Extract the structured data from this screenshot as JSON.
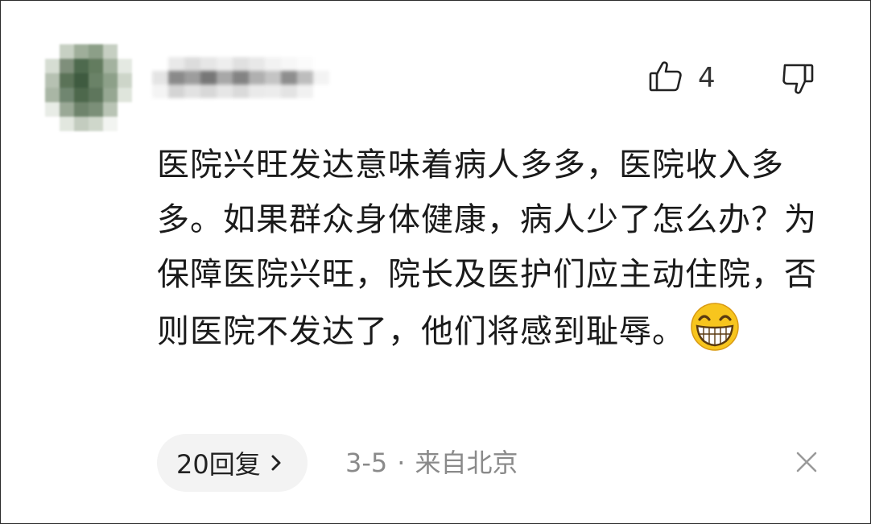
{
  "comment": {
    "like_count": "4",
    "text": "医院兴旺发达意味着病人多多，医院收入多多。如果群众身体健康，病人少了怎么办？为保障医院兴旺，院长及医护们应主动住院，否则医院不发达了，他们将感到耻辱。",
    "emoji": "grinning-face-emoji"
  },
  "footer": {
    "reply_label": "20回复",
    "date": "3-5",
    "separator": "·",
    "location": "来自北京"
  },
  "icons": {
    "like": "thumbs-up-icon",
    "dislike": "thumbs-down-icon",
    "reply_chevron": "chevron-right-icon",
    "close": "close-icon"
  },
  "colors": {
    "text": "#1a1a1a",
    "meta": "#8a8a8a",
    "reply_bg": "#f3f3f3",
    "emoji_yellow": "#f7c51e"
  }
}
